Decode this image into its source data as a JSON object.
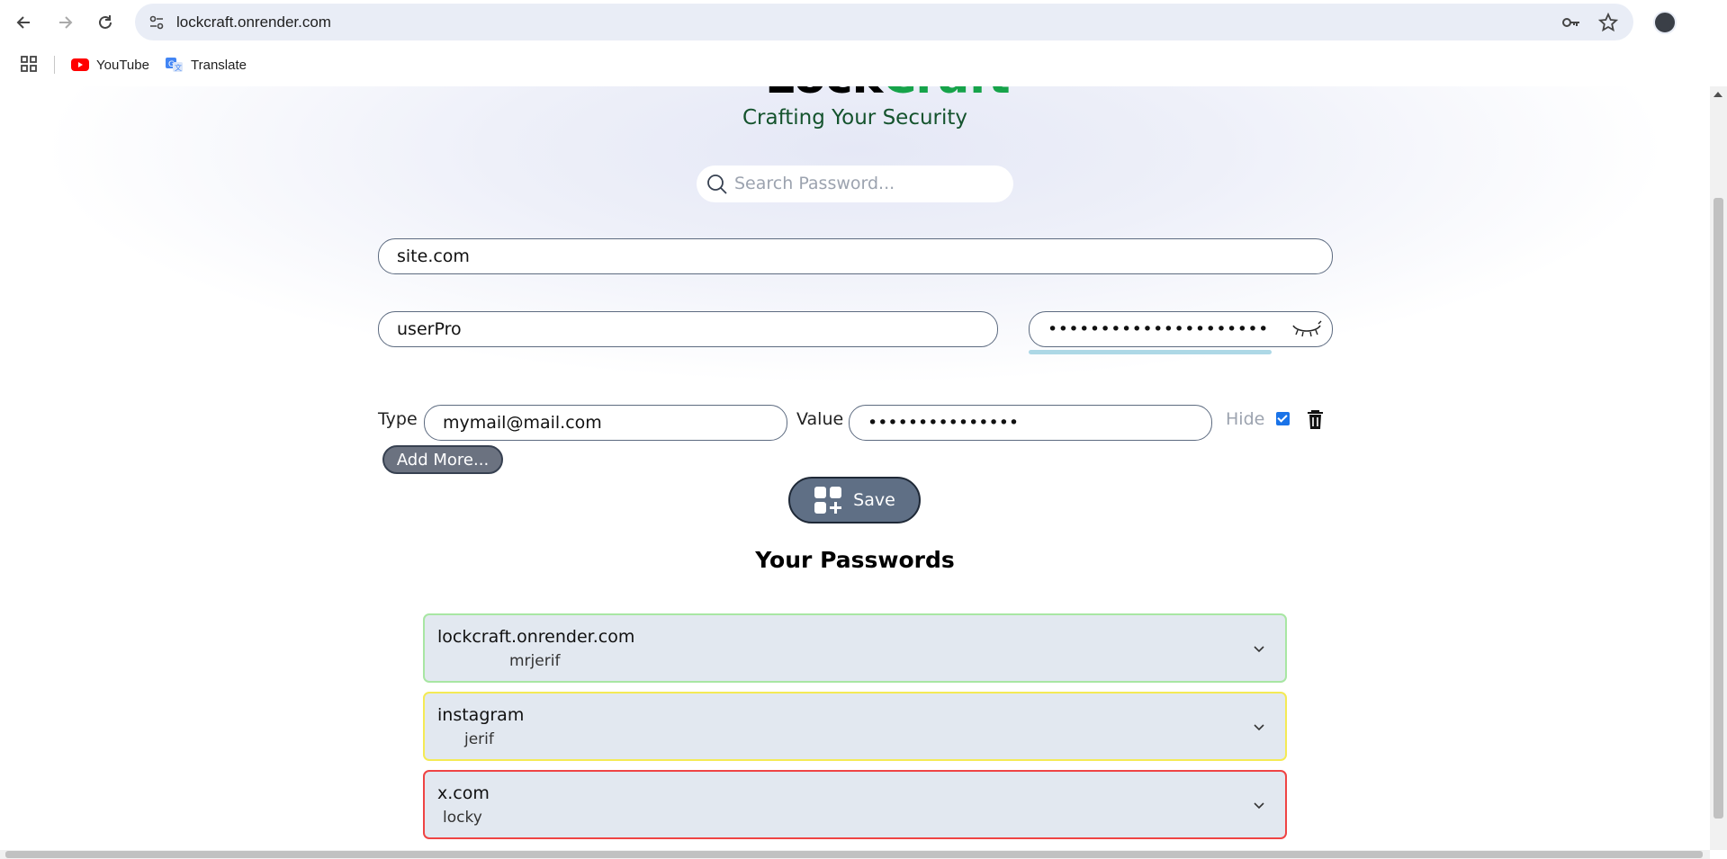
{
  "browser": {
    "url": "lockcraft.onrender.com",
    "bookmarks": [
      {
        "label": "YouTube",
        "icon": "youtube-icon"
      },
      {
        "label": "Translate",
        "icon": "translate-icon"
      }
    ]
  },
  "app": {
    "logo_part1": "Lock",
    "logo_part2": "Craft",
    "tagline": "Crafting Your Security",
    "brand_color": "#16a34a"
  },
  "search": {
    "placeholder": "Search Password..."
  },
  "form": {
    "site_value": "site.com",
    "username_value": "userPro",
    "password_masked": "•••••••••••••••••••••",
    "extra_field": {
      "type_label": "Type",
      "type_value": "mymail@mail.com",
      "value_label": "Value",
      "value_masked": "•••••••••••••••",
      "hide_label": "Hide",
      "hide_checked": true
    },
    "add_more_label": "Add More...",
    "save_label": "Save"
  },
  "passwords": {
    "title": "Your Passwords",
    "items": [
      {
        "site": "lockcraft.onrender.com",
        "username": "mrjerif",
        "border_color": "#a8e6a3"
      },
      {
        "site": "instagram",
        "username": "jerif",
        "border_color": "#f4ea55"
      },
      {
        "site": "x.com",
        "username": "locky",
        "border_color": "#ef4444"
      }
    ]
  }
}
